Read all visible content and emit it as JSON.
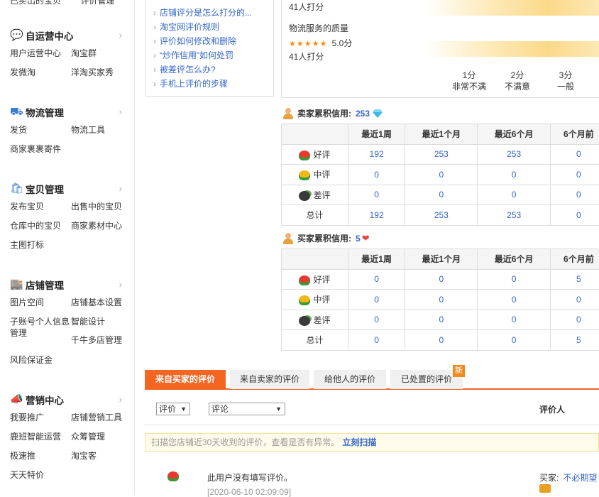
{
  "sidebar": {
    "top_partial": [
      "已卖出的宝贝",
      "评价管理"
    ],
    "sections": [
      {
        "title": "自运营中心",
        "icon": "chat-icon",
        "links": [
          "用户运营中心",
          "淘宝群",
          "发微淘",
          "洋淘买家秀"
        ]
      },
      {
        "title": "物流管理",
        "icon": "truck-icon",
        "links": [
          "发货",
          "物流工具",
          "商家裹裹寄件"
        ]
      },
      {
        "title": "宝贝管理",
        "icon": "bag-icon",
        "links": [
          "发布宝贝",
          "出售中的宝贝",
          "仓库中的宝贝",
          "商家素材中心",
          "主图打标"
        ]
      },
      {
        "title": "店铺管理",
        "icon": "store-icon",
        "links": [
          "图片空间",
          "店铺基本设置",
          "子账号个人信息管理",
          "智能设计",
          "",
          "千牛多店管理",
          "风险保证金"
        ]
      },
      {
        "title": "营销中心",
        "icon": "megaphone-icon",
        "links": [
          "我要推广",
          "店铺营销工具",
          "鹿班智能运营",
          "众筹管理",
          "极速推",
          "淘宝客",
          "天天特价"
        ]
      }
    ]
  },
  "help": {
    "links": [
      "店铺评分是怎么打分的...",
      "淘宝网评价规则",
      "评价如何修改和删除",
      "“炒作信用”如何处罚",
      "被差评怎么办?",
      "手机上评价的步骤"
    ]
  },
  "ratings": {
    "top_count": "41人打分",
    "logistics_label": "物流服务的质量",
    "logistics_stars": "★★★★★",
    "logistics_score": "5.0分",
    "logistics_count": "41人打分",
    "scale": [
      {
        "score": "1分",
        "desc": "非常不满"
      },
      {
        "score": "2分",
        "desc": "不满意"
      },
      {
        "score": "3分",
        "desc": "一般"
      }
    ]
  },
  "seller_credit": {
    "label": "卖家累积信用:",
    "value": "253",
    "headers": [
      "",
      "最近1周",
      "最近1个月",
      "最近6个月",
      "6个月前"
    ],
    "rows": [
      {
        "label": "好评",
        "icon": "red-flower-icon",
        "values": [
          "192",
          "253",
          "253",
          "0"
        ]
      },
      {
        "label": "中评",
        "icon": "yellow-flower-icon",
        "values": [
          "0",
          "0",
          "0",
          "0"
        ]
      },
      {
        "label": "差评",
        "icon": "bomb-icon",
        "values": [
          "0",
          "0",
          "0",
          "0"
        ]
      },
      {
        "label": "总计",
        "icon": "",
        "values": [
          "192",
          "253",
          "253",
          "0"
        ]
      }
    ]
  },
  "buyer_credit": {
    "label": "买家累积信用:",
    "value": "5",
    "headers": [
      "",
      "最近1周",
      "最近1个月",
      "最近6个月",
      "6个月前"
    ],
    "rows": [
      {
        "label": "好评",
        "icon": "red-flower-icon",
        "values": [
          "0",
          "0",
          "0",
          "5"
        ]
      },
      {
        "label": "中评",
        "icon": "yellow-flower-icon",
        "values": [
          "0",
          "0",
          "0",
          "0"
        ]
      },
      {
        "label": "差评",
        "icon": "bomb-icon",
        "values": [
          "0",
          "0",
          "0",
          "0"
        ]
      },
      {
        "label": "总计",
        "icon": "",
        "values": [
          "0",
          "0",
          "0",
          "5"
        ]
      }
    ]
  },
  "tabs": [
    "来自买家的评价",
    "来自卖家的评价",
    "给他人的评价",
    "已处置的评价"
  ],
  "new_badge": "新",
  "filters": {
    "rating_select": "评价",
    "comment_select": "评论",
    "reviewer_col": "评价人"
  },
  "notice": {
    "text": "扫描您店铺近30天收到的评价，查看是否有异常。",
    "link": "立刻扫描"
  },
  "review": {
    "text": "此用户没有填写评价。",
    "date": "[2020-06-10 02:09:09]",
    "buyer_label": "买家:",
    "buyer_name": "不必期望"
  },
  "colors": {
    "accent": "#f26522",
    "link": "#3366cc",
    "header_bg": "#f5f5f5"
  }
}
